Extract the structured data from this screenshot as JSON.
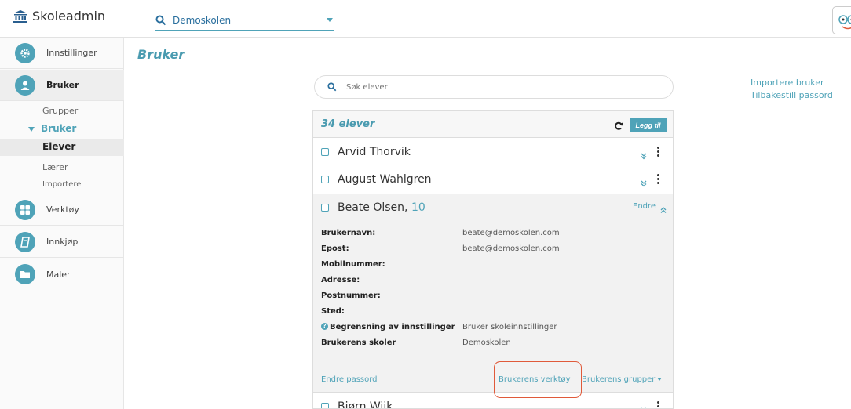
{
  "app": {
    "title": "Skoleadmin"
  },
  "school_select": {
    "value": "Demoskolen"
  },
  "sidebar": {
    "items": [
      {
        "label": "Innstillinger",
        "icon": "gear-icon"
      },
      {
        "label": "Bruker",
        "icon": "user-icon"
      },
      {
        "label": "Verktøy",
        "icon": "grid-icon"
      },
      {
        "label": "Innkjøp",
        "icon": "book-icon"
      },
      {
        "label": "Maler",
        "icon": "folder-icon"
      }
    ],
    "sub": {
      "grupper": "Grupper",
      "bruker": "Bruker",
      "elever": "Elever",
      "laerer": "Lærer",
      "importere": "Importere"
    }
  },
  "page": {
    "title": "Bruker"
  },
  "search": {
    "placeholder": "Søk elever"
  },
  "right_links": {
    "import": "Importere bruker",
    "reset": "Tilbakestill passord"
  },
  "list": {
    "count": "34 elever",
    "add_label": "Legg til",
    "rows": [
      {
        "name": "Arvid Thorvik"
      },
      {
        "name": "August Wahlgren"
      }
    ],
    "expanded": {
      "name": "Beate Olsen,",
      "age": "10",
      "edit_label": "Endre",
      "fields": [
        {
          "key": "Brukernavn:",
          "value": "beate@demoskolen.com"
        },
        {
          "key": "Epost:",
          "value": "beate@demoskolen.com"
        },
        {
          "key": "Mobilnummer:",
          "value": ""
        },
        {
          "key": "Adresse:",
          "value": ""
        },
        {
          "key": "Postnummer:",
          "value": ""
        },
        {
          "key": "Sted:",
          "value": ""
        },
        {
          "key": "Begrensning av innstillinger",
          "value": "Bruker skoleinnstillinger"
        },
        {
          "key": "Brukerens skoler",
          "value": "Demoskolen"
        }
      ],
      "actions": {
        "password": "Endre passord",
        "tools": "Brukerens verktøy",
        "groups": "Brukerens grupper"
      }
    },
    "last_row": {
      "name": "Bjørn Wiik"
    }
  },
  "colors": {
    "accent": "#4fa3b8",
    "highlight": "#e05a3a"
  }
}
